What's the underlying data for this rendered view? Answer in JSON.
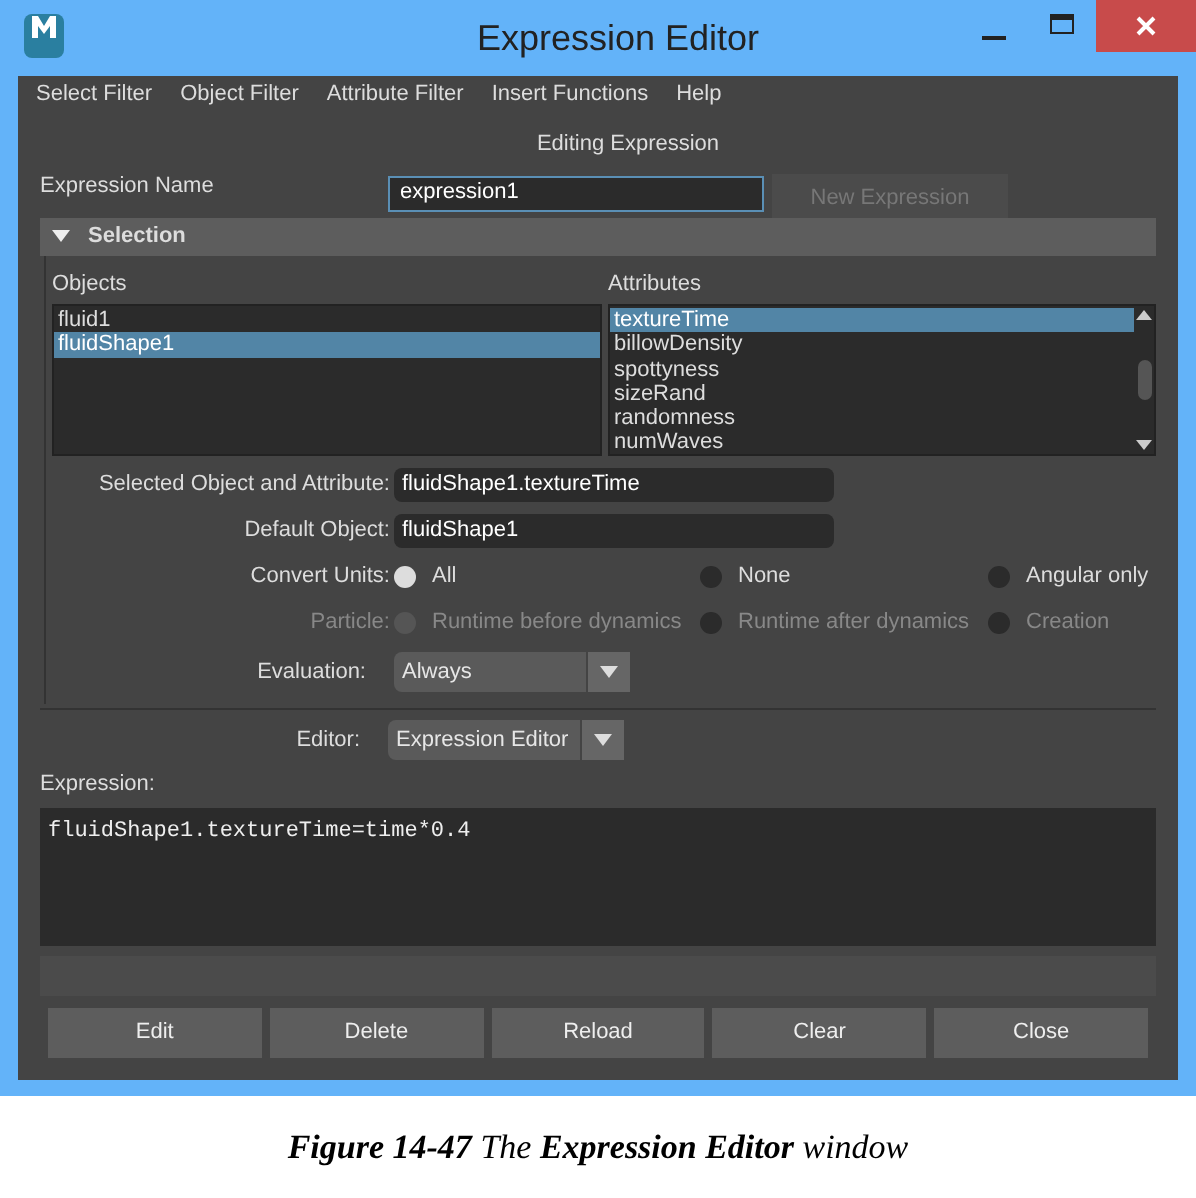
{
  "window": {
    "title": "Expression Editor"
  },
  "menu": [
    "Select Filter",
    "Object Filter",
    "Attribute Filter",
    "Insert Functions",
    "Help"
  ],
  "heading": "Editing Expression",
  "name_field": {
    "label": "Expression Name",
    "value": "expression1"
  },
  "new_button": {
    "label": "New Expression",
    "disabled": true
  },
  "selection": {
    "title": "Selection",
    "expanded": true,
    "objects": {
      "label": "Objects",
      "items": [
        {
          "text": "fluid1",
          "selected": false
        },
        {
          "text": "fluidShape1",
          "selected": true
        }
      ]
    },
    "attributes": {
      "label": "Attributes",
      "items": [
        {
          "text": "textureTime",
          "selected": true
        },
        {
          "text": "billowDensity",
          "selected": false
        },
        {
          "text": "spottyness",
          "selected": false
        },
        {
          "text": "sizeRand",
          "selected": false
        },
        {
          "text": "randomness",
          "selected": false
        },
        {
          "text": "numWaves",
          "selected": false
        }
      ]
    },
    "fields": [
      {
        "label": "Selected Object and Attribute:",
        "value": "fluidShape1.textureTime"
      },
      {
        "label": "Default Object:",
        "value": "fluidShape1"
      }
    ],
    "radio_groups": [
      {
        "label": "Convert Units:",
        "disabled": false,
        "options": [
          {
            "text": "All",
            "selected": true
          },
          {
            "text": "None",
            "selected": false
          },
          {
            "text": "Angular only",
            "selected": false
          }
        ]
      },
      {
        "label": "Particle:",
        "disabled": true,
        "options": [
          {
            "text": "Runtime before dynamics",
            "selected": false
          },
          {
            "text": "Runtime after dynamics",
            "selected": false
          },
          {
            "text": "Creation",
            "selected": false
          }
        ]
      }
    ],
    "evaluation": {
      "label": "Evaluation:",
      "value": "Always"
    }
  },
  "editor": {
    "label": "Editor:",
    "value": "Expression Editor"
  },
  "expression": {
    "label": "Expression:",
    "code": "fluidShape1.textureTime=time*0.4"
  },
  "buttons": [
    "Edit",
    "Delete",
    "Reload",
    "Clear",
    "Close"
  ],
  "caption": "**Figure 14-47** The **Expression Editor** window"
}
